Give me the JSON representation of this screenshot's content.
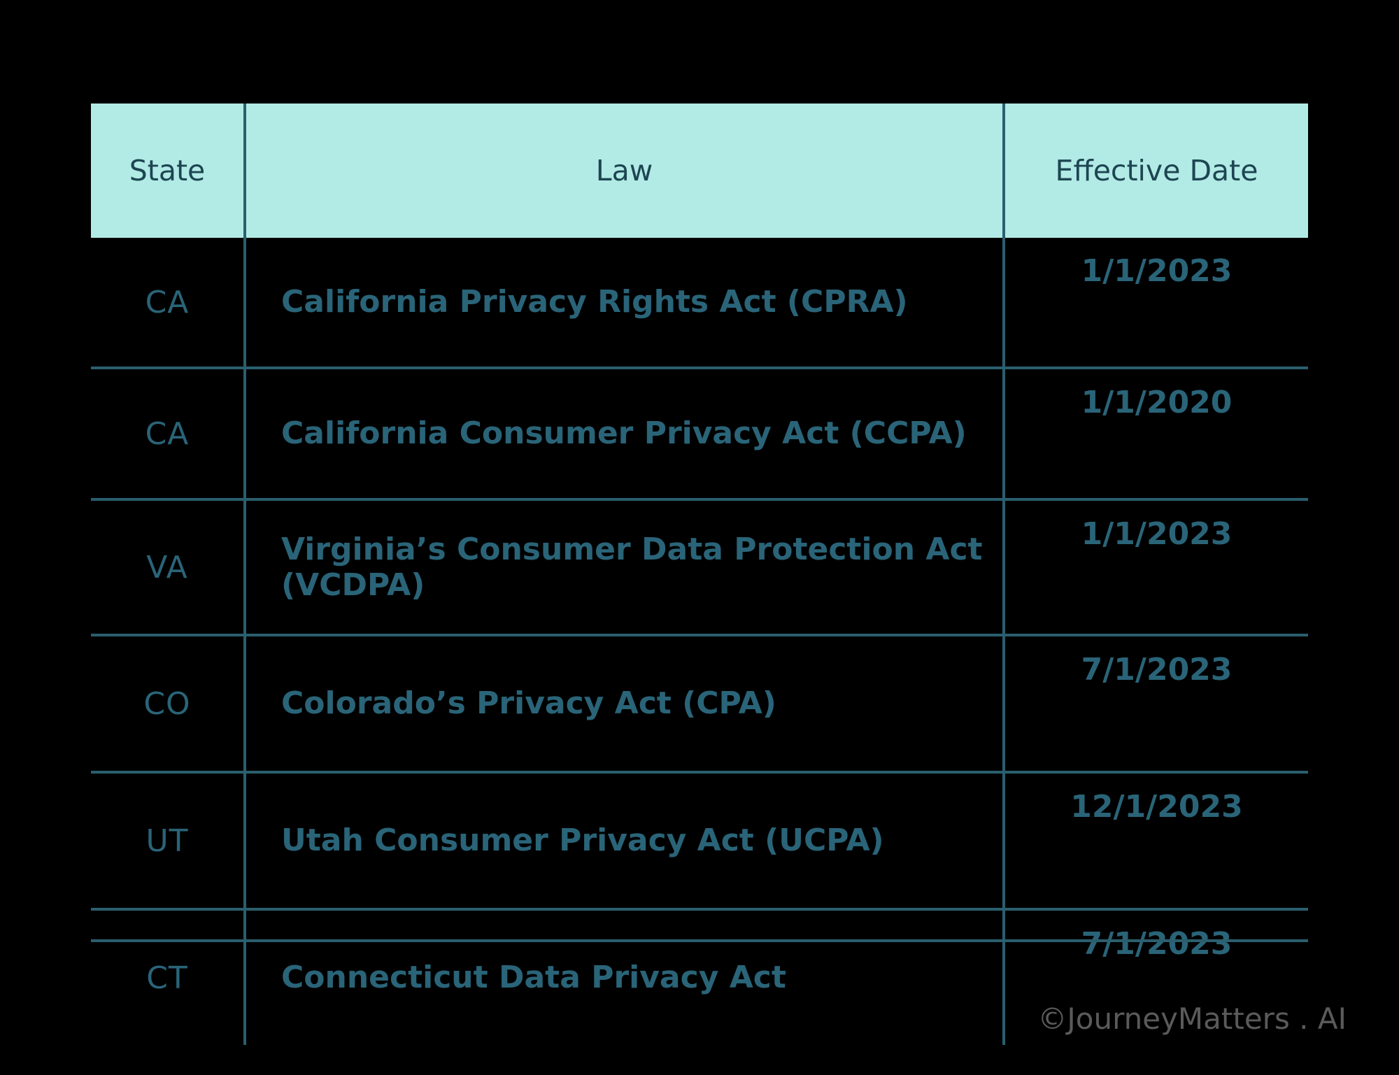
{
  "table": {
    "columns": [
      {
        "key": "state",
        "label": "State"
      },
      {
        "key": "law",
        "label": "Law"
      },
      {
        "key": "date",
        "label": "Effective Date"
      }
    ],
    "rows": [
      {
        "state": "CA",
        "law": "California Privacy Rights Act (CPRA)",
        "date": "1/1/2023"
      },
      {
        "state": "CA",
        "law": "California Consumer Privacy Act (CCPA)",
        "date": "1/1/2020"
      },
      {
        "state": "VA",
        "law": "Virginia’s Consumer Data Protection Act (VCDPA)",
        "date": "1/1/2023"
      },
      {
        "state": "CO",
        "law": "Colorado’s Privacy Act (CPA)",
        "date": "7/1/2023"
      },
      {
        "state": "UT",
        "law": "Utah Consumer Privacy Act (UCPA)",
        "date": "12/1/2023"
      },
      {
        "state": "CT",
        "law": "Connecticut Data Privacy Act",
        "date": "7/1/2023"
      }
    ]
  },
  "watermark": {
    "text": "©JourneyMatters . AI"
  },
  "colors": {
    "background": "#000000",
    "header_fill": "#b2ebe5",
    "header_text": "#1d4552",
    "rule": "#2a5f6e",
    "body_text": "#2a6478",
    "watermark_text": "#5a5a5a"
  }
}
